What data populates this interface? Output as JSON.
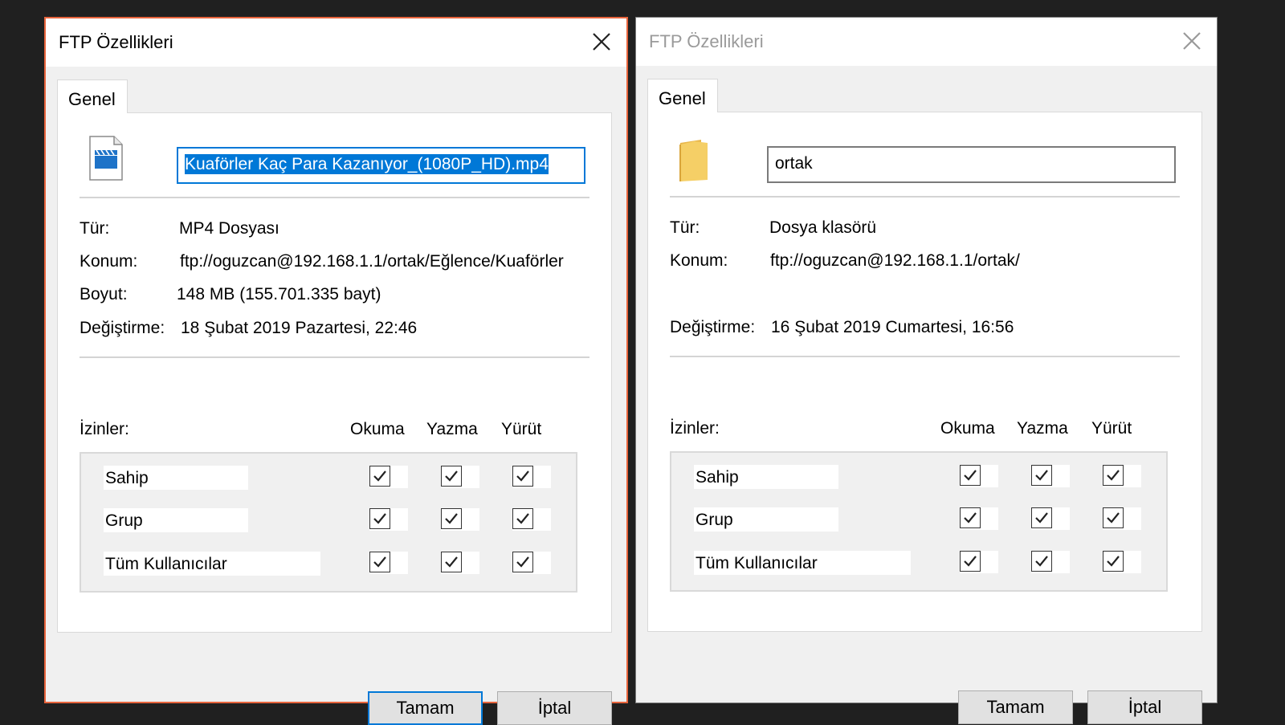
{
  "dialogs": [
    {
      "title": "FTP Özellikleri",
      "tab": "Genel",
      "name_value": "Kuaförler Kaç Para Kazanıyor_(1080P_HD).mp4",
      "type_label": "Tür:",
      "type_value": "MP4 Dosyası",
      "location_label": "Konum:",
      "location_value": "ftp://oguzcan@192.168.1.1/ortak/Eğlence/Kuaförler",
      "size_label": "Boyut:",
      "size_value": "148 MB (155.701.335 bayt)",
      "modified_label": "Değiştirme:",
      "modified_value": "18 Şubat 2019 Pazartesi, 22:46",
      "permissions_label": "İzinler:",
      "col_read": "Okuma",
      "col_write": "Yazma",
      "col_execute": "Yürüt",
      "rows": [
        "Sahip",
        "Grup",
        "Tüm Kullanıcılar"
      ],
      "ok_label": "Tamam",
      "cancel_label": "İptal",
      "icon": "video-file-icon",
      "active": true
    },
    {
      "title": "FTP Özellikleri",
      "tab": "Genel",
      "name_value": "ortak",
      "type_label": "Tür:",
      "type_value": "Dosya klasörü",
      "location_label": "Konum:",
      "location_value": "ftp://oguzcan@192.168.1.1/ortak/",
      "modified_label": "Değiştirme:",
      "modified_value": "16 Şubat 2019 Cumartesi, 16:56",
      "permissions_label": "İzinler:",
      "col_read": "Okuma",
      "col_write": "Yazma",
      "col_execute": "Yürüt",
      "rows": [
        "Sahip",
        "Grup",
        "Tüm Kullanıcılar"
      ],
      "ok_label": "Tamam",
      "cancel_label": "İptal",
      "icon": "folder-icon",
      "active": false
    }
  ],
  "colors": {
    "accent": "#0078d7",
    "active_border": "#e8643c",
    "background": "#202020"
  }
}
